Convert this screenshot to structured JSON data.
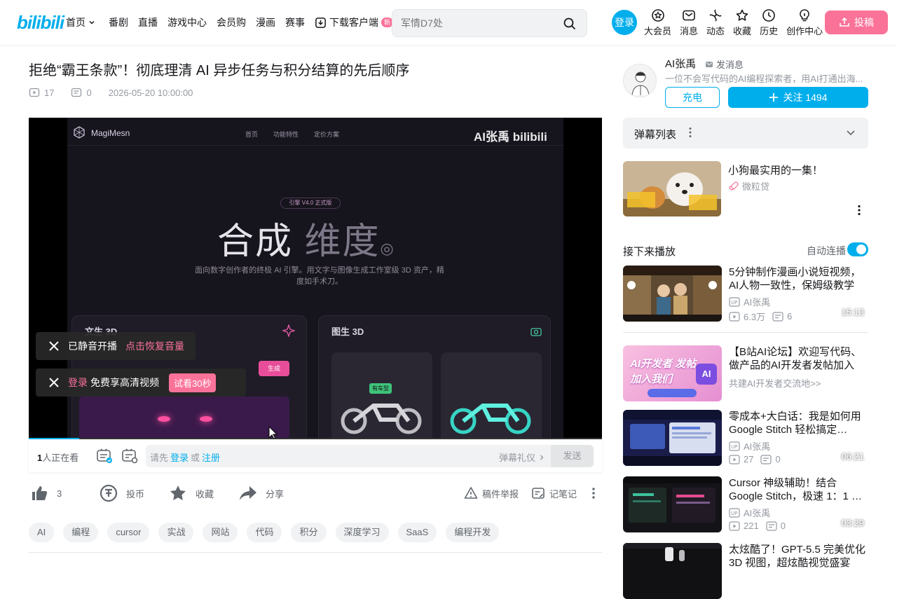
{
  "header": {
    "logo": "bilibili",
    "nav": [
      "首页",
      "番剧",
      "直播",
      "游戏中心",
      "会员购",
      "漫画",
      "赛事",
      "下载客户端"
    ],
    "new_badge": "新",
    "search_placeholder": "军情D7处",
    "login": "登录",
    "icons": [
      {
        "label": "大会员",
        "icon": "vip-icon"
      },
      {
        "label": "消息",
        "icon": "message-icon"
      },
      {
        "label": "动态",
        "icon": "dynamic-icon"
      },
      {
        "label": "收藏",
        "icon": "favorite-icon"
      },
      {
        "label": "历史",
        "icon": "history-icon"
      },
      {
        "label": "创作中心",
        "icon": "creator-icon"
      }
    ],
    "upload": "投稿"
  },
  "video": {
    "title": "拒绝“霸王条款”！彻底理清 AI 异步任务与积分结算的先后顺序",
    "views": "17",
    "danmaku_count": "0",
    "date": "2026-05-20 10:00:00",
    "progress_fraction": 0.088
  },
  "frame": {
    "brand": "MagiMesn",
    "nav": [
      "首页",
      "功能特性",
      "定价方案"
    ],
    "watermark": "AI张禹 bilibili",
    "pill": "引擎 V4.0 正式版",
    "headline_a": "合成",
    "headline_b": "维度",
    "subtitle": "面向数字创作者的终极 AI 引擎。用文字与图像生成工作室级 3D 资产，精度如手术刀。",
    "card1": "文生 3D",
    "card2": "图生 3D",
    "gen_btn": "生成",
    "tag_green": "有车型"
  },
  "toasts": {
    "muted": "已静音开播",
    "restore": "点击恢复音量",
    "login_link": "登录",
    "hd": "免费享高清视频",
    "try": "试看30秒"
  },
  "danmaku_bar": {
    "viewers_num": "1",
    "viewers_text": "人正在看",
    "placeholder_pre": "请先",
    "login": "登录",
    "or": "或",
    "register": "注册",
    "etiquette": "弹幕礼仪",
    "send": "发送"
  },
  "actions": {
    "like": "3",
    "coin": "投币",
    "fav": "收藏",
    "share": "分享",
    "report": "稿件举报",
    "notes": "记笔记"
  },
  "tags": [
    "AI",
    "编程",
    "cursor",
    "实战",
    "网站",
    "代码",
    "积分",
    "深度学习",
    "SaaS",
    "编程开发"
  ],
  "uploader": {
    "name": "AI张禹",
    "message": "发消息",
    "desc": "一位不会写代码的AI编程探索者，用AI打通出海...",
    "charge": "充电",
    "follow": "关注 1494"
  },
  "danmaku_list": {
    "label": "弹幕列表"
  },
  "ad": {
    "title": "小狗最实用的一集！",
    "source": "微粒贷"
  },
  "up_next": {
    "label": "接下来播放",
    "autoplay": "自动连播"
  },
  "recommendations": [
    {
      "title": "5分钟制作漫画小说短视频，AI人物一致性，保姆级教学",
      "up": "AI张禹",
      "views": "6.3万",
      "danmaku": "6",
      "duration": "15:13"
    },
    {
      "title": "【B站AI论坛】欢迎写代码、做产品的AI开发者发帖加入",
      "sub": "共建AI开发者交流地>>",
      "thumb_text": "AI开发者 发帖加入我们"
    },
    {
      "title": "零成本+大白话：我是如何用 Google Stitch 轻松搞定 SaaS...",
      "up": "AI张禹",
      "views": "27",
      "danmaku": "0",
      "duration": "06:21"
    },
    {
      "title": "Cursor 神级辅助！结合 Google Stitch，极速 1：1 还原 S...",
      "up": "AI张禹",
      "views": "221",
      "danmaku": "0",
      "duration": "03:29"
    },
    {
      "title": "太炫酷了！GPT-5.5 完美优化 3D 视图，超炫酷视觉盛宴",
      "up": "",
      "views": "",
      "danmaku": "",
      "duration": ""
    }
  ],
  "colors": {
    "accent": "#00aeec",
    "pink": "#fb7299"
  }
}
